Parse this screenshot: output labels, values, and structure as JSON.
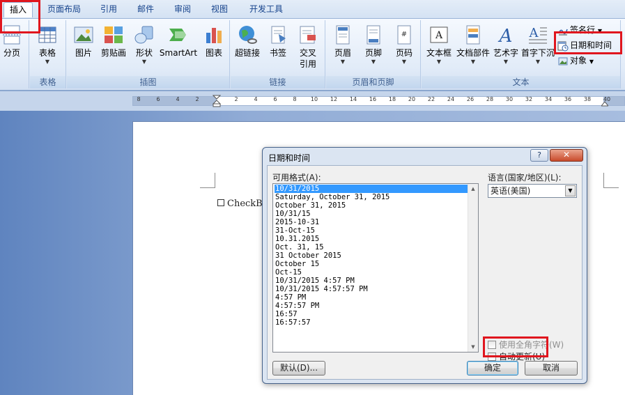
{
  "tabs": {
    "insert": "插入",
    "page_layout": "页面布局",
    "references": "引用",
    "mailings": "邮件",
    "review": "审阅",
    "view": "视图",
    "developer": "开发工具"
  },
  "ribbon": {
    "pages": {
      "page_break": "分页"
    },
    "tables": {
      "table": "表格",
      "group": "表格"
    },
    "illustrations": {
      "picture": "图片",
      "clipart": "剪贴画",
      "shapes": "形状",
      "smartart": "SmartArt",
      "chart": "图表",
      "group": "插图"
    },
    "links": {
      "hyperlink": "超链接",
      "bookmark": "书签",
      "cross_ref_1": "交叉",
      "cross_ref_2": "引用",
      "group": "链接"
    },
    "header_footer": {
      "header": "页眉",
      "footer": "页脚",
      "page_number": "页码",
      "group": "页眉和页脚"
    },
    "text": {
      "text_box": "文本框",
      "quick_parts": "文档部件",
      "wordart": "艺术字",
      "drop_cap": "首字下沉",
      "signature_line": "签名行",
      "date_time": "日期和时间",
      "object": "对象",
      "group": "文本"
    }
  },
  "ruler": {
    "labels": [
      "8",
      "6",
      "4",
      "2",
      "2",
      "4",
      "6",
      "8",
      "10",
      "12",
      "14",
      "16",
      "18",
      "20",
      "22",
      "24",
      "26",
      "28",
      "30",
      "32",
      "34",
      "36",
      "38",
      "40"
    ]
  },
  "document": {
    "checkbox_text": "CheckBo"
  },
  "dialog": {
    "title": "日期和时间",
    "help": "?",
    "close": "✕",
    "formats_label": "可用格式(A):",
    "formats": [
      "10/31/2015",
      "Saturday, October 31, 2015",
      "October 31, 2015",
      "10/31/15",
      "2015-10-31",
      "31-Oct-15",
      "10.31.2015",
      "Oct. 31, 15",
      "31 October 2015",
      "October 15",
      "Oct-15",
      "10/31/2015 4:57 PM",
      "10/31/2015 4:57:57 PM",
      "4:57 PM",
      "4:57:57 PM",
      "16:57",
      "16:57:57"
    ],
    "selected_index": 0,
    "language_label": "语言(国家/地区)(L):",
    "language_value": "英语(美国)",
    "fullwidth_label": "使用全角字符(W)",
    "auto_update_label": "自动更新(U)",
    "default_button": "默认(D)...",
    "ok_button": "确定",
    "cancel_button": "取消"
  },
  "colors": {
    "highlight": "#e0161e",
    "selection": "#3399ff"
  }
}
